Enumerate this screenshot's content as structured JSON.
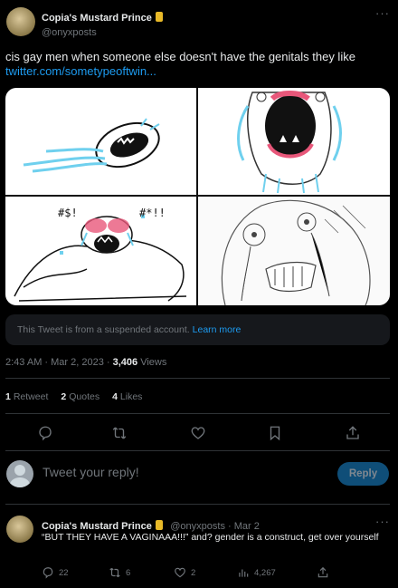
{
  "tweet": {
    "display_name": "Copia's Mustard Prince",
    "handle": "@onyxposts",
    "text": "cis gay men when someone else doesn't have the genitals they like",
    "link": "twitter.com/sometypeoftwin...",
    "media_text_1": "#$!",
    "media_text_2": "#*!!",
    "suspended_notice": "This Tweet is from a suspended account.",
    "learn_more": "Learn more",
    "timestamp": "2:43 AM · Mar 2, 2023 · ",
    "views_count": "3,406",
    "views_label": " Views",
    "retweets_count": "1",
    "retweets_label": "Retweet",
    "quotes_count": "2",
    "quotes_label": "Quotes",
    "likes_count": "4",
    "likes_label": "Likes"
  },
  "composer": {
    "placeholder": "Tweet your reply!",
    "button_label": "Reply"
  },
  "reply": {
    "display_name": "Copia's Mustard Prince",
    "handle_date": "@onyxposts · Mar 2",
    "text": "“BUT THEY HAVE A VAGINAAA!!!” and? gender is a construct, get over yourself",
    "replies": "22",
    "retweets": "6",
    "likes": "2",
    "views": "4,267"
  },
  "colors": {
    "accent": "#1d9bf0",
    "background": "#000000",
    "muted": "#71767b",
    "verified_badge": "#e8b928"
  }
}
